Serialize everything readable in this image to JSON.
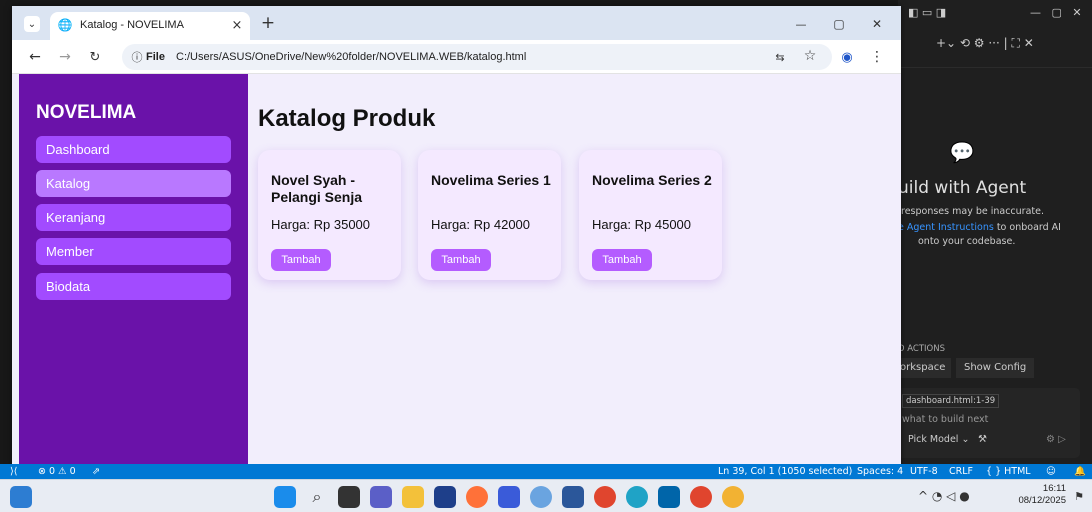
{
  "browser": {
    "tab_title": "Katalog - NOVELIMA",
    "tab_close": "×",
    "new_tab": "+",
    "file_label": "File",
    "url": "C:/Users/ASUS/OneDrive/New%20folder/NOVELIMA.WEB/katalog.html",
    "window_controls": {
      "minimize": "—",
      "maximize": "▢",
      "close": "✕"
    }
  },
  "sidebar": {
    "brand": "NOVELIMA",
    "items": [
      {
        "label": "Dashboard",
        "active": false
      },
      {
        "label": "Katalog",
        "active": true
      },
      {
        "label": "Keranjang",
        "active": false
      },
      {
        "label": "Member",
        "active": false
      },
      {
        "label": "Biodata",
        "active": false
      }
    ]
  },
  "main": {
    "title": "Katalog Produk",
    "products": [
      {
        "name": "Novel Syah - Pelangi Senja",
        "price": "Harga: Rp 35000",
        "button": "Tambah"
      },
      {
        "name": "Novelima Series 1",
        "price": "Harga: Rp 42000",
        "button": "Tambah"
      },
      {
        "name": "Novelima Series 2",
        "price": "Harga: Rp 45000",
        "button": "Tambah"
      }
    ]
  },
  "agent_panel": {
    "heading": "uild with Agent",
    "subtext": "responses may be inaccurate.",
    "link": "e Agent Instructions",
    "link_suffix": " to onboard AI",
    "line3": "onto your codebase.",
    "actions_heading": "D ACTIONS",
    "btn_workspace": "orkspace",
    "btn_config": "Show Config",
    "context_chip": "dashboard.html:1-39",
    "input_placeholder": "what to build next",
    "pick_model": "Pick Model ⌄"
  },
  "statusbar": {
    "problems": "⊗ 0 ⚠ 0",
    "position": "Ln 39, Col 1 (1050 selected)",
    "spaces": "Spaces: 4",
    "encoding": "UTF-8",
    "eol": "CRLF",
    "language": "{ } HTML"
  },
  "taskbar": {
    "time": "16:11",
    "date": "08/12/2025"
  },
  "colors": {
    "sidebar_bg": "#6a12a9",
    "nav_item": "#a24bff",
    "card_bg": "#f4e9ff",
    "button": "#b45cff",
    "status_bar": "#0078d4"
  }
}
